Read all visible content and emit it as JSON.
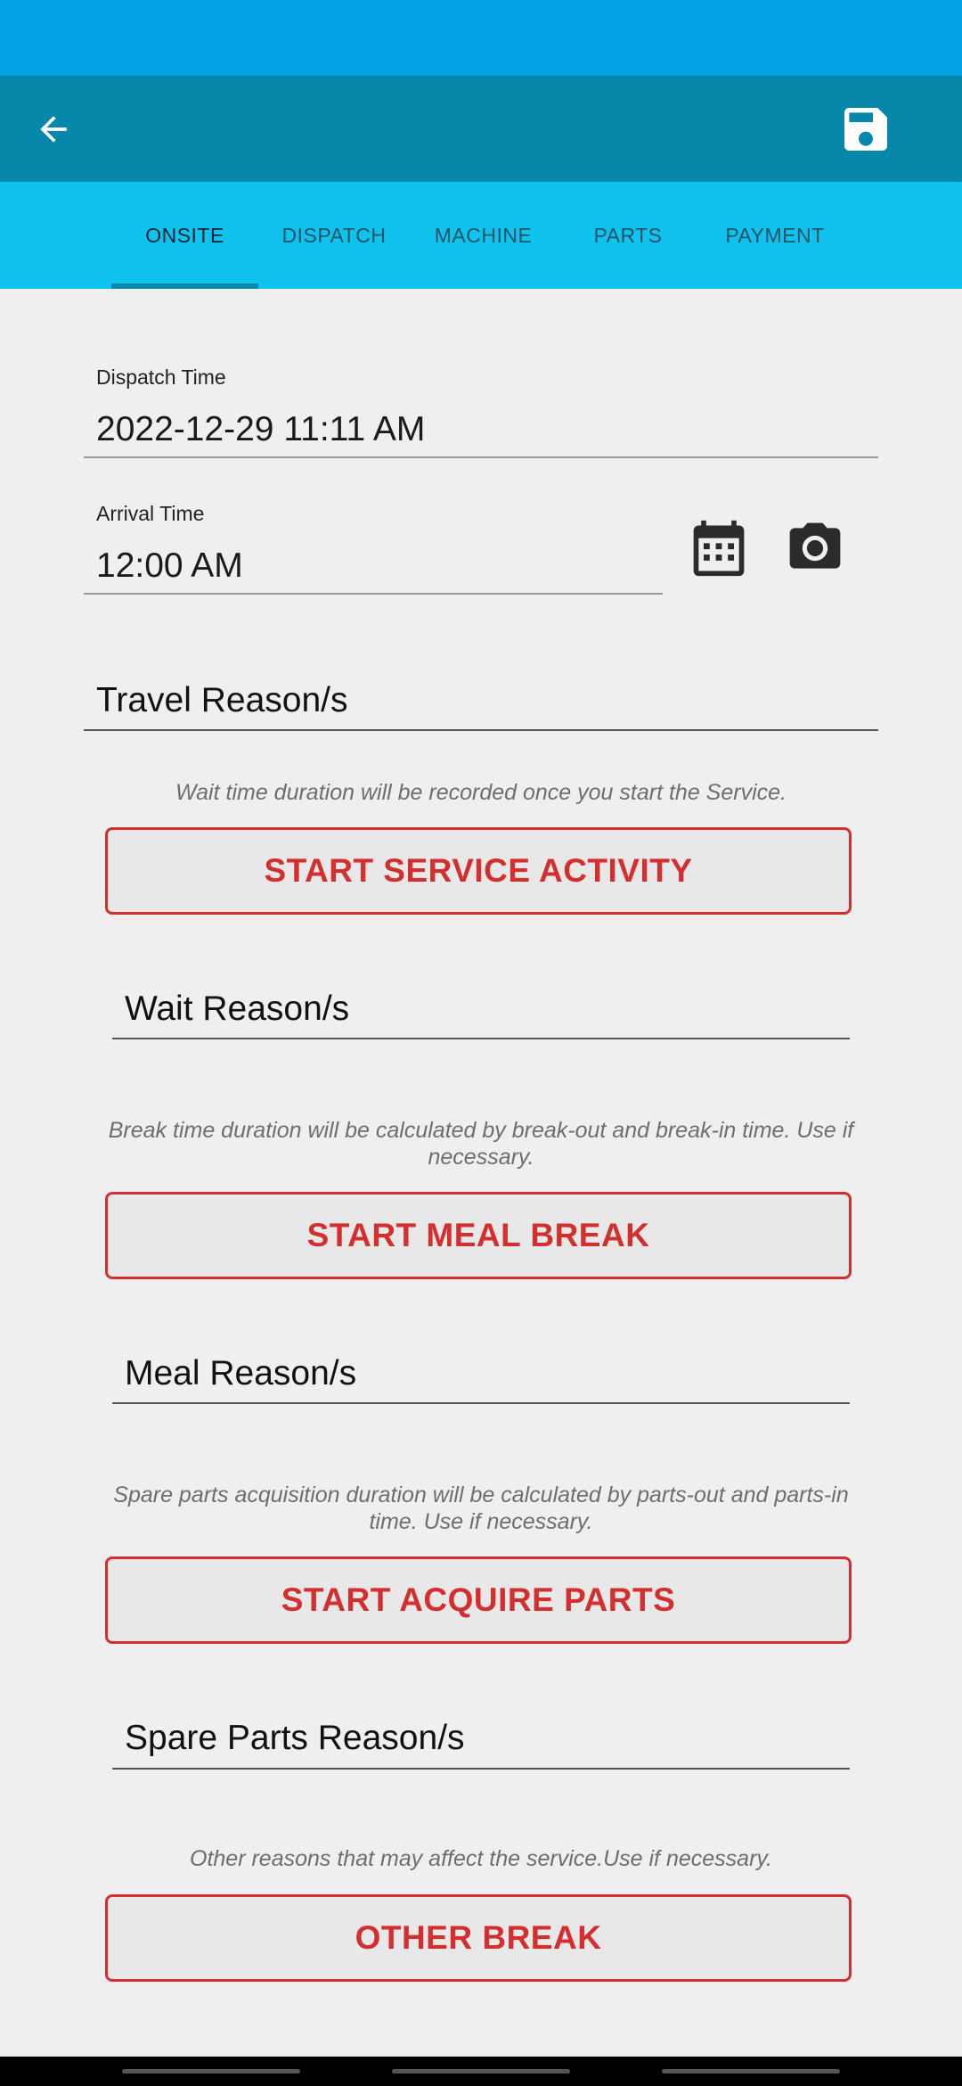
{
  "colors": {
    "status_bar": "#03a1e6",
    "toolbar": "#0787a9",
    "tab_bar": "#10c2ee",
    "accent_red": "#d32f2f",
    "background": "#efefef"
  },
  "toolbar": {
    "back_icon": "arrow-left-icon",
    "save_icon": "save-icon"
  },
  "tabs": [
    {
      "label": "ONSITE",
      "active": true
    },
    {
      "label": "DISPATCH",
      "active": false
    },
    {
      "label": "MACHINE",
      "active": false
    },
    {
      "label": "PARTS",
      "active": false
    },
    {
      "label": "PAYMENT",
      "active": false
    }
  ],
  "dispatch": {
    "label": "Dispatch Time",
    "value": "2022-12-29 11:11 AM"
  },
  "arrival": {
    "label": "Arrival Time",
    "value": "12:00 AM",
    "calendar_icon": "calendar-icon",
    "camera_icon": "camera-icon"
  },
  "travel": {
    "placeholder": "Travel Reason/s"
  },
  "service": {
    "hint": "Wait time duration will be recorded once you start the Service.",
    "button": "START SERVICE ACTIVITY",
    "reason_placeholder": "Wait Reason/s"
  },
  "meal": {
    "hint": "Break time duration will be calculated by break-out and break-in time. Use if necessary.",
    "button": "START MEAL BREAK",
    "reason_placeholder": "Meal Reason/s"
  },
  "parts": {
    "hint": "Spare parts acquisition duration will be calculated by parts-out and parts-in time. Use if necessary.",
    "button": "START ACQUIRE PARTS",
    "reason_placeholder": "Spare Parts Reason/s"
  },
  "other": {
    "hint": "Other reasons that may affect the service.Use if necessary.",
    "button": "OTHER BREAK"
  }
}
